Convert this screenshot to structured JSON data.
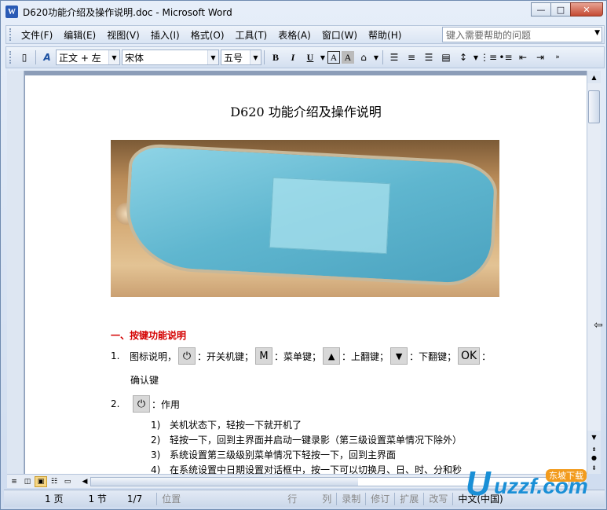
{
  "window": {
    "title": "D620功能介绍及操作说明.doc - Microsoft Word",
    "controls": {
      "minimize": "—",
      "maximize": "□",
      "close": "✕"
    }
  },
  "menubar": {
    "items": [
      "文件(F)",
      "编辑(E)",
      "视图(V)",
      "插入(I)",
      "格式(O)",
      "工具(T)",
      "表格(A)",
      "窗口(W)",
      "帮助(H)"
    ],
    "help_placeholder": "键入需要帮助的问题"
  },
  "toolbar": {
    "style": "正文 + 左",
    "font": "宋体",
    "size": "五号",
    "bold": "B",
    "italic": "I",
    "underline": "U",
    "font_color": "A",
    "char_shading": "A"
  },
  "document": {
    "title": "D620 功能介绍及操作说明",
    "section1_heading": "一、按键功能说明",
    "item1_num": "1.",
    "item1_prefix": "图标说明，",
    "item1_power_label": "：开关机键；",
    "item1_m_icon": "M",
    "item1_m_label": "：菜单键；",
    "item1_up_label": "：上翻键；",
    "item1_down_label": "：下翻键；",
    "item1_ok_icon": "OK",
    "item1_ok_label": "：",
    "item1_cont": "确认键",
    "item2_num": "2.",
    "item2_label": "：作用",
    "sub_items": [
      {
        "n": "1)",
        "t": "关机状态下，轻按一下就开机了"
      },
      {
        "n": "2)",
        "t": "轻按一下，回到主界面并启动一键录影（第三级设置菜单情况下除外）"
      },
      {
        "n": "3)",
        "t": "系统设置第三级级别菜单情况下轻按一下，回到主界面"
      },
      {
        "n": "4)",
        "t": "在系统设置中日期设置对话框中，按一下可以切换月、日、时、分和秒"
      }
    ]
  },
  "statusbar": {
    "page": "1 页",
    "section": "1 节",
    "pages": "1/7",
    "position": "位置",
    "line": "行",
    "col": "列",
    "rec": "录制",
    "trk": "修订",
    "ext": "扩展",
    "ovr": "改写",
    "lang": "中文(中国)"
  },
  "watermark": {
    "brand": "uzzf.com",
    "tag": "东坡下载"
  },
  "colors": {
    "heading_red": "#d40000",
    "chrome_blue": "#cfdcef"
  }
}
